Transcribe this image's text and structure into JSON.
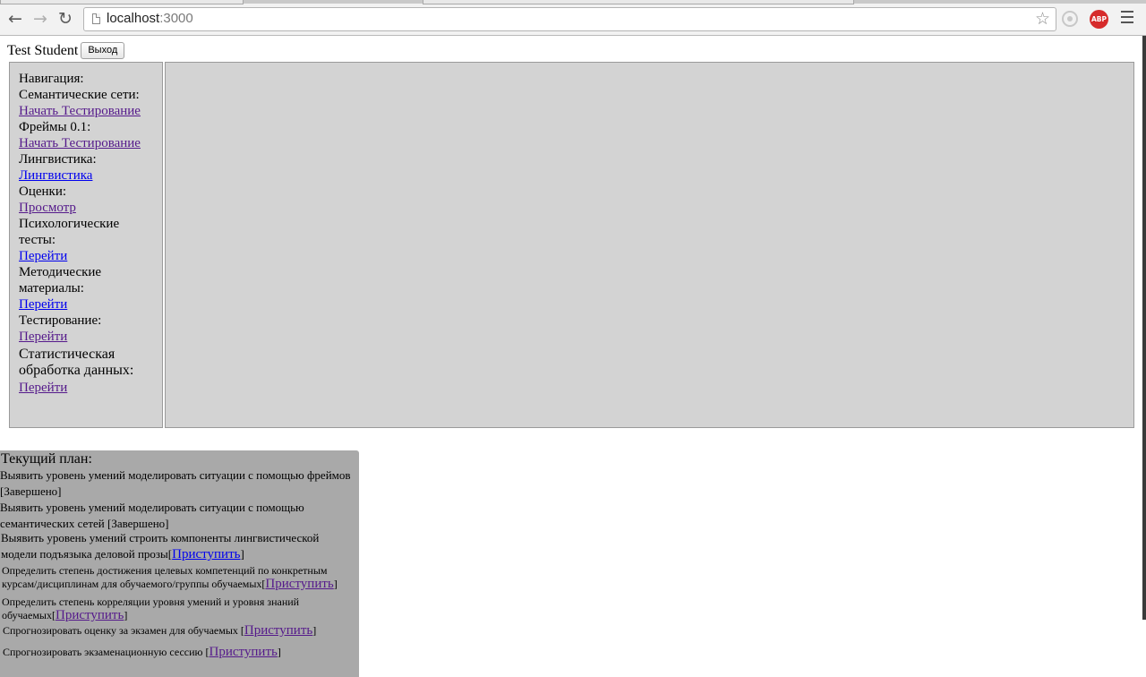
{
  "browser": {
    "url_host": "localhost",
    "url_port": ":3000",
    "icons": [
      "back-icon",
      "forward-icon",
      "reload-icon",
      "page-icon",
      "star-icon",
      "extension-icon",
      "adblock-icon",
      "menu-icon"
    ],
    "adblock_label": "ABP"
  },
  "user": {
    "name": "Test Student",
    "logout_label": "Выход"
  },
  "sidebar": {
    "nav_title": "Навигация:",
    "sections": [
      {
        "label": "Семантические сети:",
        "link": "Начать Тестирование",
        "visited": true
      },
      {
        "label": "Фреймы 0.1:",
        "link": "Начать Тестирование",
        "visited": true
      },
      {
        "label": "Лингвистика:",
        "link": "Лингвистика",
        "visited": false
      },
      {
        "label": "Оценки:",
        "link": "Просмотр",
        "visited": true
      },
      {
        "label": "Психологические тесты:",
        "link": "Перейти",
        "visited": false
      },
      {
        "label": "Методические материалы:",
        "link": "Перейти",
        "visited": false
      },
      {
        "label": "Тестирование:",
        "link": "Перейти",
        "visited": true
      },
      {
        "label": "Статистическая обработка данных:",
        "link": "Перейти",
        "visited": true
      }
    ]
  },
  "plan": {
    "title": "Текущий план:",
    "items": [
      {
        "text": "Выявить уровень умений моделировать ситуации с помощью фреймов [Завершено]"
      },
      {
        "text": "Выявить уровень умений моделировать ситуации с помощью семантических сетей [Завершено]"
      },
      {
        "text": "Выявить уровень умений строить компоненты лингвистической модели подъязыка деловой прозы",
        "action": "Приступить"
      },
      {
        "text": "Определить степень достижения целевых компетенций по конкретным курсам/дисциплинам для обучаемого/группы обучаемых",
        "action": "Приступить"
      },
      {
        "text": "Определить степень корреляции уровня умений и уровня знаний обучаемых",
        "action": "Приступить"
      },
      {
        "text": "Спрогнозировать оценку за экзамен для обучаемых",
        "action": "Приступить"
      },
      {
        "text": "Спрогнозировать экзаменационную сессию",
        "action": "Приступить"
      }
    ]
  }
}
